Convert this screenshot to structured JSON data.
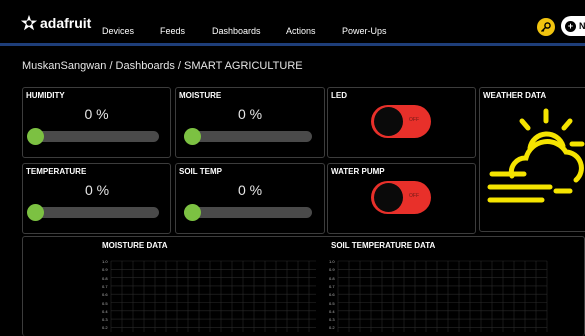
{
  "header": {
    "logo_text": "adafruit",
    "nav": [
      "Devices",
      "Feeds",
      "Dashboards",
      "Actions",
      "Power-Ups"
    ],
    "new_button_label": "Ne"
  },
  "breadcrumb": "MuskanSangwan / Dashboards / SMART AGRICULTURE",
  "gauges": [
    {
      "title": "HUMIDITY",
      "value": "0 %",
      "level": 0
    },
    {
      "title": "MOISTURE",
      "value": "0 %",
      "level": 0
    },
    {
      "title": "TEMPERATURE",
      "value": "0 %",
      "level": 0
    },
    {
      "title": "SOIL TEMP",
      "value": "0 %",
      "level": 0
    }
  ],
  "toggles": [
    {
      "title": "LED",
      "state_label": "OFF"
    },
    {
      "title": "WATER PUMP",
      "state_label": "OFF"
    }
  ],
  "weather": {
    "title": "WEATHER DATA",
    "icon": "cloud-sun-icon"
  },
  "charts": [
    {
      "title": "MOISTURE DATA",
      "yticks": [
        "1.0",
        "0.9",
        "0.8",
        "0.7",
        "0.6",
        "0.5",
        "0.4",
        "0.3",
        "0.2"
      ]
    },
    {
      "title": "SOIL TEMPERATURE DATA",
      "yticks": [
        "1.0",
        "0.9",
        "0.8",
        "0.7",
        "0.6",
        "0.5",
        "0.4",
        "0.3",
        "0.2"
      ]
    }
  ],
  "colors": {
    "accent_bar": "#1e3e7a",
    "slider_knob": "#7cc142",
    "toggle_off": "#e8302a",
    "weather_icon": "#f5e400",
    "key_button": "#f1c40f"
  }
}
